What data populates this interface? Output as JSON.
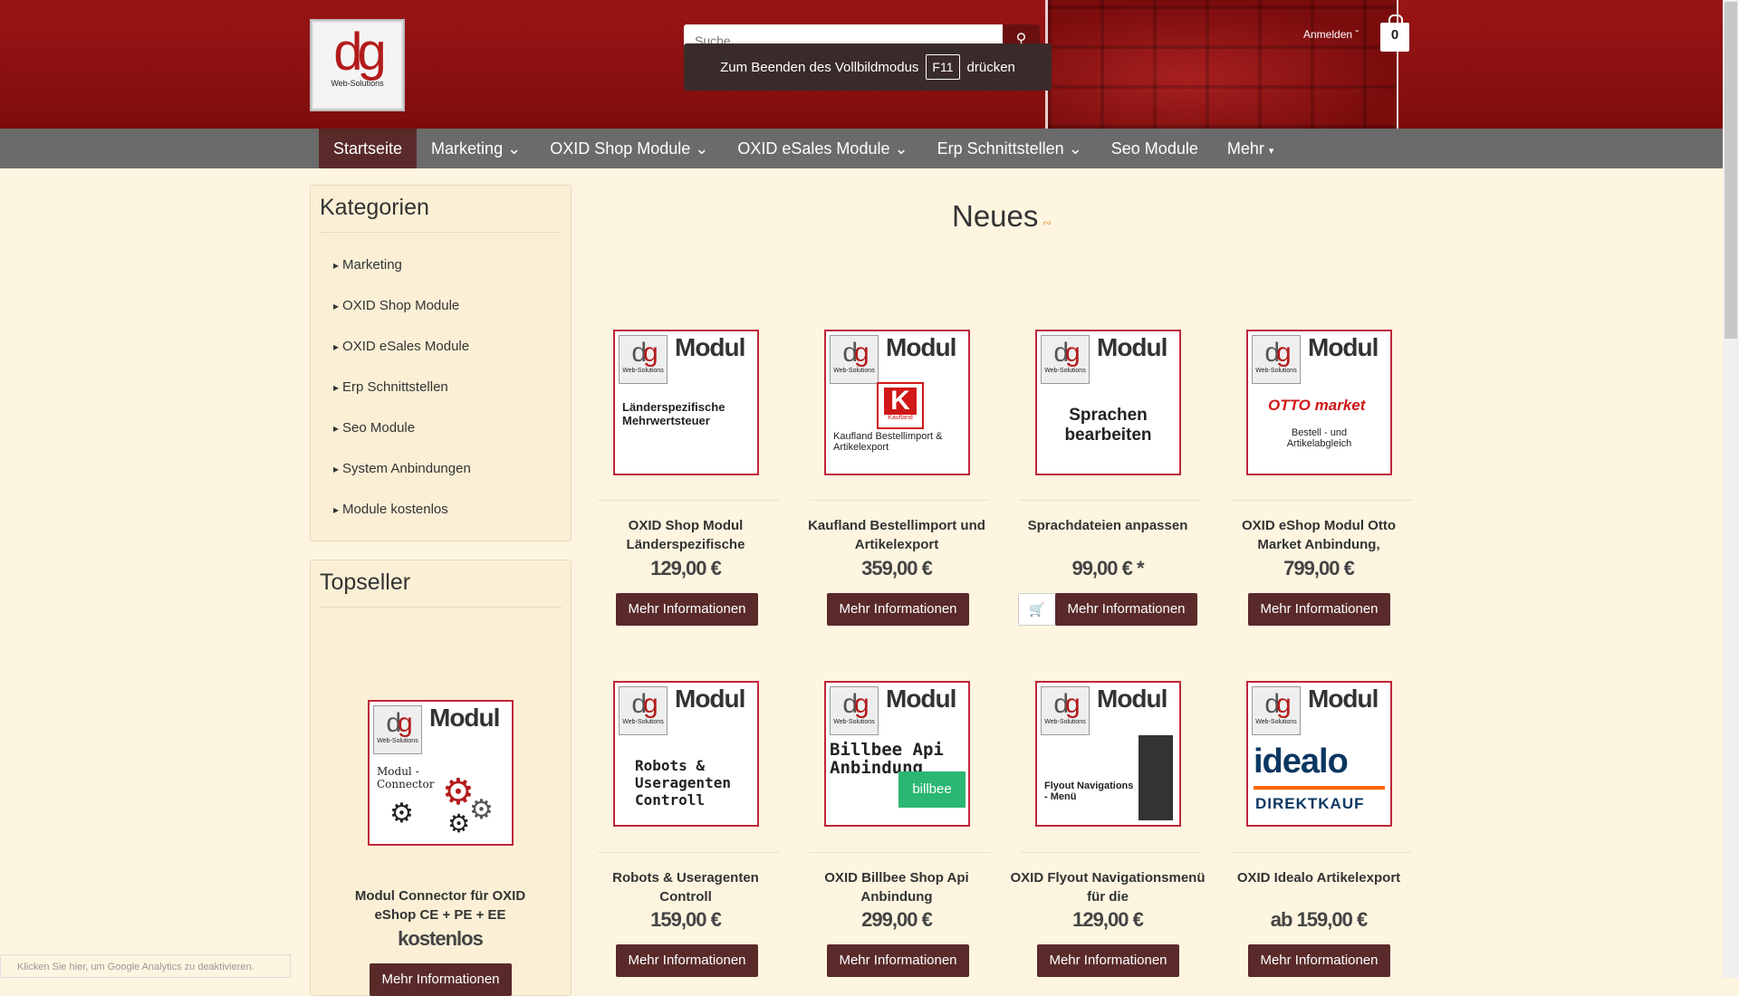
{
  "header": {
    "logo_text_left": "d",
    "logo_text_right": "g",
    "logo_sub": "Web-Solutions",
    "search_placeholder": "Suche",
    "fullscreen_before": "Zum Beenden des Vollbildmodus",
    "fullscreen_key": "F11",
    "fullscreen_after": "drücken",
    "login": "Anmelden",
    "cart_count": "0"
  },
  "nav": [
    "Startseite",
    "Marketing",
    "OXID Shop Module",
    "OXID eSales Module",
    "Erp Schnittstellen",
    "Seo Module",
    "Mehr"
  ],
  "sidebar": {
    "categories_title": "Kategorien",
    "categories": [
      "Marketing",
      "OXID Shop Module",
      "OXID eSales Module",
      "Erp Schnittstellen",
      "Seo Module",
      "System Anbindungen",
      "Module kostenlos"
    ],
    "topseller_title": "Topseller",
    "topseller": {
      "tile_text": "Modul - Connector",
      "name": "Modul Connector für OXID eShop CE + PE + EE",
      "price": "kostenlos",
      "button": "Mehr Informationen"
    }
  },
  "main": {
    "title": "Neues",
    "tile_brand": "Modul",
    "products": [
      {
        "tile": "Länderspezifische Mehrwertsteuer",
        "name": "OXID Shop Modul Länderspezifische",
        "price": "129,00 €",
        "button": "Mehr Informationen"
      },
      {
        "tile": "Kaufland Bestellimport & Artikelexport",
        "name": "Kaufland Bestellimport und Artikelexport",
        "price": "359,00 €",
        "button": "Mehr Informationen"
      },
      {
        "tile": "Sprachen bearbeiten",
        "name": "Sprachdateien anpassen",
        "price": "99,00 € *",
        "button": "Mehr Informationen"
      },
      {
        "tile": "Bestell - und Artikelabgleich",
        "name": "OXID eShop Modul Otto Market Anbindung,",
        "price": "799,00 €",
        "button": "Mehr Informationen"
      },
      {
        "tile": "Robots & Useragenten Controll",
        "name": "Robots & Useragenten Controll",
        "price": "159,00 €",
        "button": "Mehr Informationen"
      },
      {
        "tile": "Billbee Api Anbindung",
        "name": "OXID Billbee Shop Api Anbindung",
        "price": "299,00 €",
        "button": "Mehr Informationen"
      },
      {
        "tile": "Flyout Navigations - Menü",
        "name": "OXID Flyout Navigationsmenü für die",
        "price": "129,00 €",
        "button": "Mehr Informationen"
      },
      {
        "tile": "idealo DIREKTKAUF",
        "name": "OXID Idealo Artikelexport",
        "price": "ab 159,00 €",
        "button": "Mehr Informationen"
      }
    ],
    "otto_logo": "OTTO market",
    "kaufland_logo": "Kaufland",
    "billbee_logo": "billbee"
  },
  "footer_note": "Klicken Sie hier, um Google Analytics zu deaktivieren."
}
